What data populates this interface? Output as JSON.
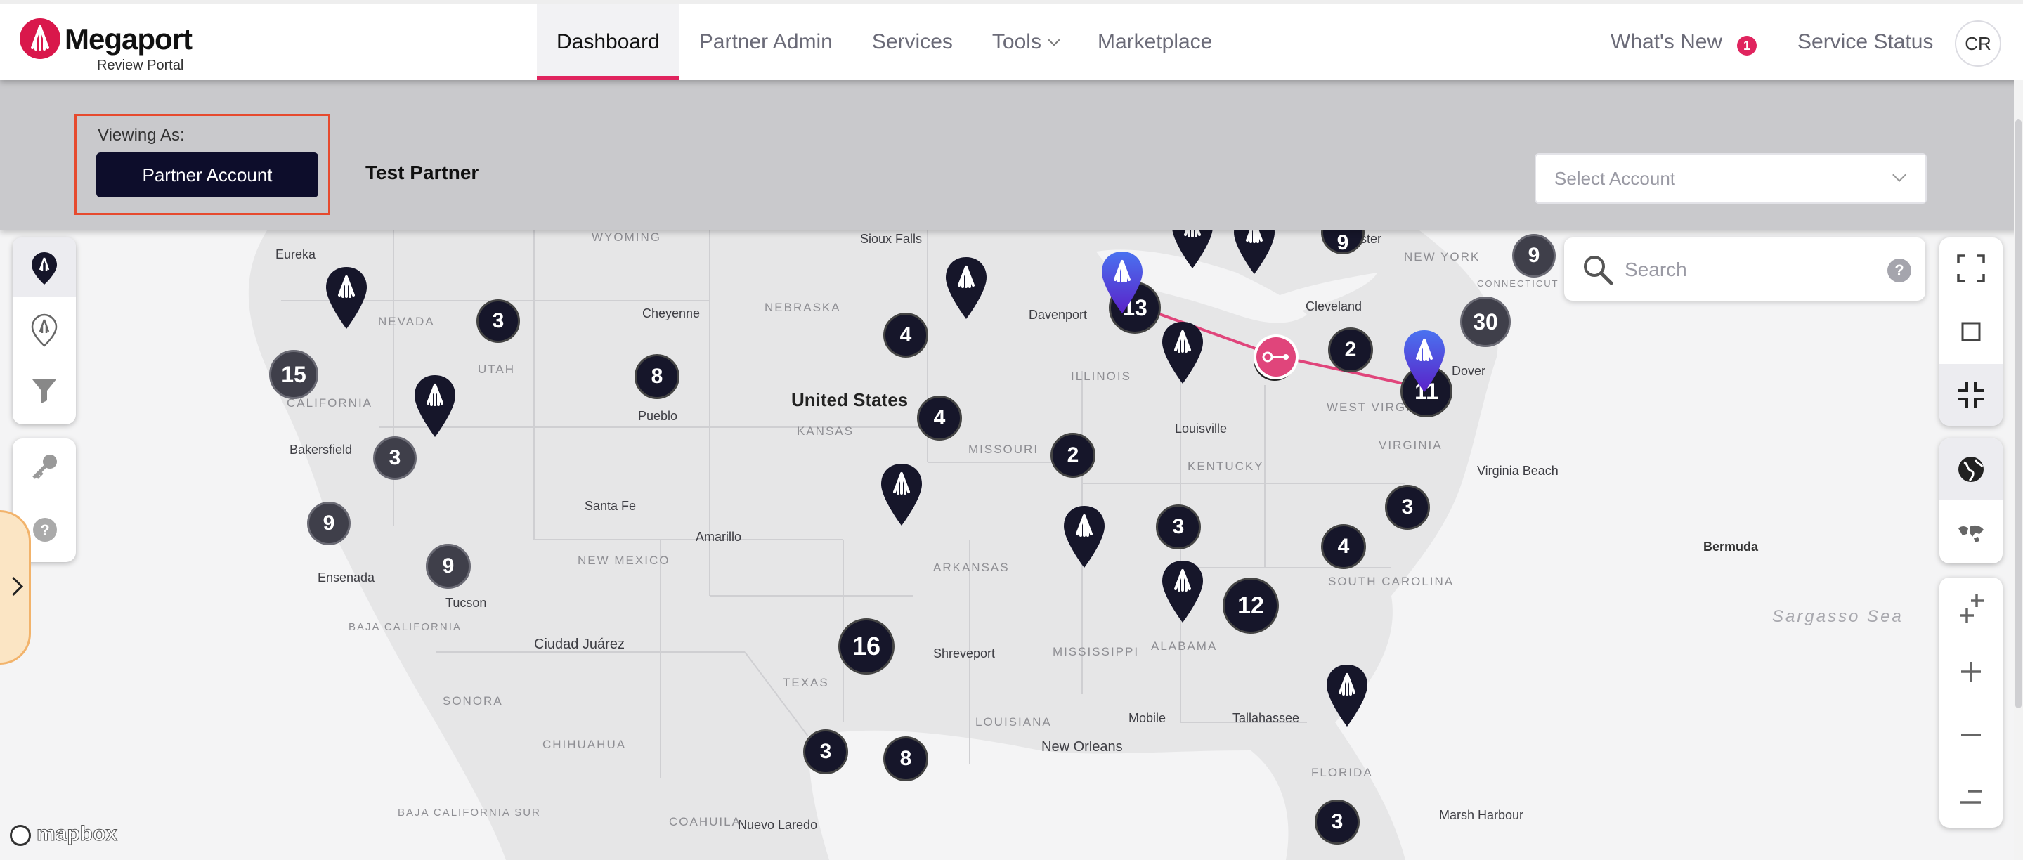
{
  "header": {
    "brand": "Megaport",
    "portal_name": "Review Portal",
    "nav": [
      {
        "label": "Dashboard",
        "active": true
      },
      {
        "label": "Partner Admin"
      },
      {
        "label": "Services"
      },
      {
        "label": "Tools",
        "has_dropdown": true
      },
      {
        "label": "Marketplace"
      }
    ],
    "whats_new_label": "What's New",
    "whats_new_count": "1",
    "service_status_label": "Service Status",
    "user_initials": "CR"
  },
  "viewing_as": {
    "label": "Viewing As:",
    "account_button": "Partner Account",
    "partner_name": "Test Partner",
    "select_placeholder": "Select Account"
  },
  "map": {
    "search_placeholder": "Search",
    "help_label": "?",
    "attribution": "mapbox",
    "country_label": "United States",
    "state_labels": [
      "WYOMING",
      "NEBRASKA",
      "NEVADA",
      "UTAH",
      "CALIFORNIA",
      "KANSAS",
      "MISSOURI",
      "ILLINOIS",
      "KENTUCKY",
      "WEST VIRGINIA",
      "VIRGINIA",
      "NEW YORK",
      "CONNECTICUT",
      "NEW MEXICO",
      "ARKANSAS",
      "MISSISSIPPI",
      "ALABAMA",
      "SOUTH CAROLINA",
      "TEXAS",
      "LOUISIANA",
      "FLORIDA",
      "SONORA",
      "CHIHUAHUA",
      "COAHUILA",
      "BAJA CALIFORNIA",
      "BAJA CALIFORNIA SUR"
    ],
    "city_labels": [
      "Eureka",
      "Sioux Falls",
      "Rochester",
      "Cheyenne",
      "Davenport",
      "Cleveland",
      "Pueblo",
      "Bakersfield",
      "Louisville",
      "Dover",
      "Virginia Beach",
      "Santa Fe",
      "Amarillo",
      "Ensenada",
      "Tucson",
      "Ciudad Juárez",
      "Shreveport",
      "Mobile",
      "Tallahassee",
      "New Orleans",
      "Nuevo Laredo",
      "Marsh Harbour",
      "Bermuda"
    ],
    "sea_label": "Sargasso Sea",
    "clusters": [
      "15",
      "3",
      "3",
      "9",
      "9",
      "8",
      "4",
      "4",
      "2",
      "13",
      "2",
      "11",
      "30",
      "9",
      "9",
      "3",
      "3",
      "4",
      "12",
      "16",
      "3",
      "8",
      "3"
    ],
    "accent_colors": {
      "brand": "#d9174b",
      "navy": "#0d0d2b",
      "connection": "#e0457b",
      "highlight": "#e64a2e",
      "pin_blue": "#3d47d9"
    }
  },
  "toolbar_left": [
    "megaport-location-icon",
    "partner-location-icon",
    "filter-icon",
    "key-icon",
    "help-icon"
  ],
  "toolbar_right": [
    "fullscreen-icon",
    "square-icon",
    "collapse-icon",
    "globe-icon",
    "world-map-icon",
    "zoom-in-extra-icon",
    "zoom-in-icon",
    "zoom-out-icon",
    "zoom-out-extra-icon"
  ]
}
